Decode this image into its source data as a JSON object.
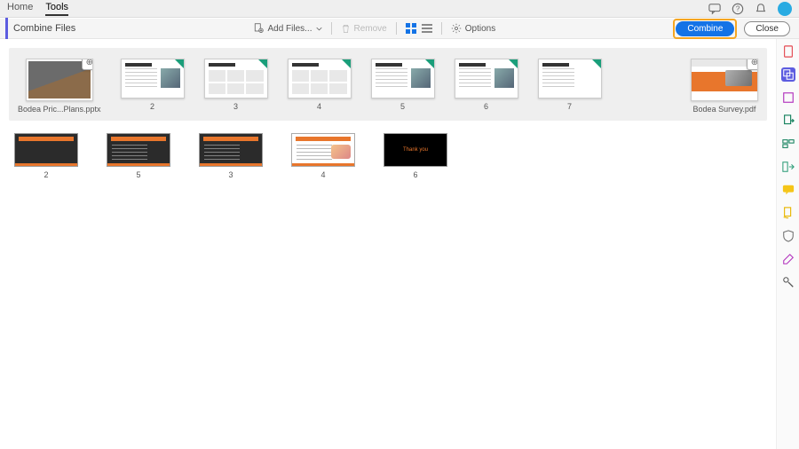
{
  "top": {
    "tabs": {
      "home": "Home",
      "tools": "Tools"
    }
  },
  "toolbar": {
    "title": "Combine Files",
    "add_files": "Add Files...",
    "remove": "Remove",
    "options": "Options",
    "combine": "Combine",
    "close": "Close"
  },
  "group1": {
    "file_label": "Bodea Pric...Plans.pptx",
    "pages": [
      "",
      "2",
      "3",
      "4",
      "5",
      "6",
      "7"
    ]
  },
  "group1_right": {
    "file_label": "Bodea Survey.pdf"
  },
  "loose": {
    "labels": [
      "2",
      "5",
      "3",
      "4",
      "6"
    ],
    "thank": "Thank you"
  },
  "rail_icons": [
    "pdf-icon",
    "combine-icon",
    "stamp-icon",
    "export-icon",
    "organize-icon",
    "compare-icon",
    "comment-icon",
    "protect-icon",
    "shield-icon",
    "redact-icon",
    "sign-icon"
  ]
}
